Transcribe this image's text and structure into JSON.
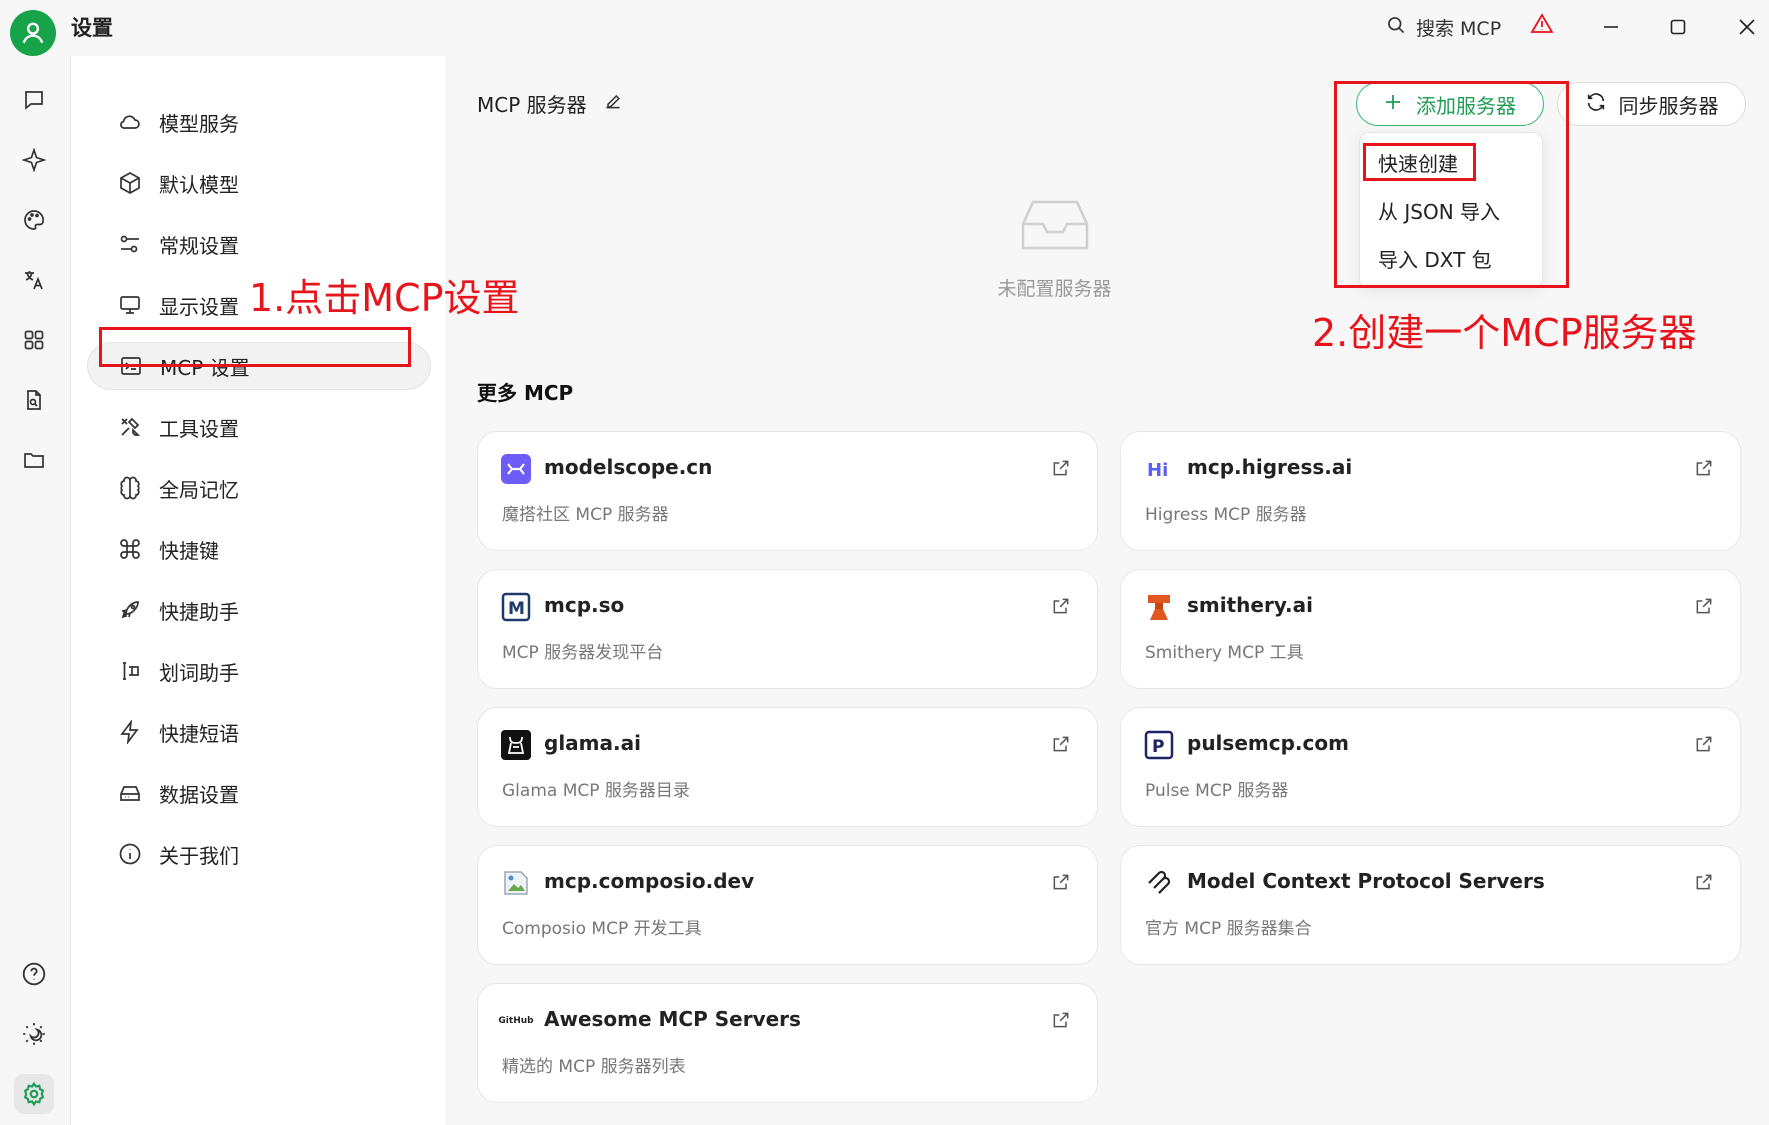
{
  "window": {
    "title": "设置",
    "search_label": "搜索 MCP"
  },
  "rail": {
    "icons": [
      "chat-icon",
      "sparkle-icon",
      "palette-icon",
      "translate-icon",
      "apps-grid-icon",
      "document-search-icon",
      "folder-icon",
      "help-icon",
      "theme-icon",
      "settings-icon"
    ]
  },
  "sidebar": {
    "items": [
      {
        "label": "模型服务",
        "icon": "cloud-icon"
      },
      {
        "label": "默认模型",
        "icon": "cube-icon"
      },
      {
        "label": "常规设置",
        "icon": "sliders-icon"
      },
      {
        "label": "显示设置",
        "icon": "monitor-icon"
      },
      {
        "label": "MCP 设置",
        "icon": "terminal-icon"
      },
      {
        "label": "工具设置",
        "icon": "tools-icon"
      },
      {
        "label": "全局记忆",
        "icon": "brain-icon"
      },
      {
        "label": "快捷键",
        "icon": "command-icon"
      },
      {
        "label": "快捷助手",
        "icon": "rocket-icon"
      },
      {
        "label": "划词助手",
        "icon": "text-select-icon"
      },
      {
        "label": "快捷短语",
        "icon": "lightning-icon"
      },
      {
        "label": "数据设置",
        "icon": "hard-drive-icon"
      },
      {
        "label": "关于我们",
        "icon": "info-icon"
      }
    ]
  },
  "main": {
    "title": "MCP 服务器",
    "add_button": "添加服务器",
    "sync_button": "同步服务器",
    "dropdown": [
      "快速创建",
      "从 JSON 导入",
      "导入 DXT 包"
    ],
    "empty_label": "未配置服务器",
    "more_title": "更多 MCP",
    "cards": [
      {
        "name": "modelscope.cn",
        "desc": "魔搭社区 MCP 服务器",
        "logo": "modelscope-logo"
      },
      {
        "name": "mcp.higress.ai",
        "desc": "Higress MCP 服务器",
        "logo": "higress-logo"
      },
      {
        "name": "mcp.so",
        "desc": "MCP 服务器发现平台",
        "logo": "mcp-so-logo"
      },
      {
        "name": "smithery.ai",
        "desc": "Smithery MCP 工具",
        "logo": "smithery-logo"
      },
      {
        "name": "glama.ai",
        "desc": "Glama MCP 服务器目录",
        "logo": "glama-logo"
      },
      {
        "name": "pulsemcp.com",
        "desc": "Pulse MCP 服务器",
        "logo": "pulsemcp-logo"
      },
      {
        "name": "mcp.composio.dev",
        "desc": "Composio MCP 开发工具",
        "logo": "broken-image-icon"
      },
      {
        "name": "Model Context Protocol Servers",
        "desc": "官方 MCP 服务器集合",
        "logo": "mcp-protocol-logo"
      },
      {
        "name": "Awesome MCP Servers",
        "desc": "精选的 MCP 服务器列表",
        "logo": "github-logo",
        "logo_text": "GitHub"
      }
    ]
  },
  "annotations": {
    "step1": "1.点击MCP设置",
    "step2": "2.创建一个MCP服务器"
  },
  "colors": {
    "accent": "#1f9d55",
    "annotation": "#e8141b"
  }
}
